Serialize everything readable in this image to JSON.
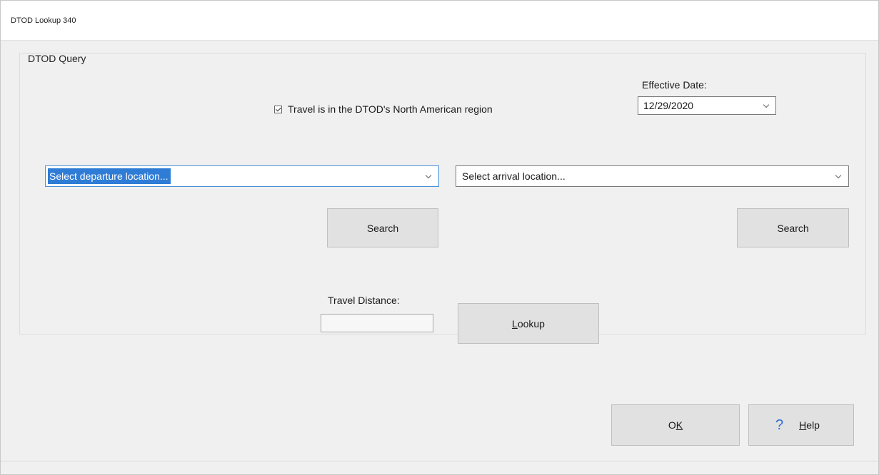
{
  "window": {
    "title": "DTOD Lookup 340"
  },
  "group": {
    "label": "DTOD Query"
  },
  "region_checkbox": {
    "label": "Travel is in the DTOD's North American region",
    "checked": true
  },
  "effective_date": {
    "label": "Effective Date:",
    "value": "12/29/2020"
  },
  "departure": {
    "value": "Select departure location..."
  },
  "arrival": {
    "value": "Select arrival location..."
  },
  "buttons": {
    "search": "Search",
    "lookup_prefix": "L",
    "lookup_rest": "ookup",
    "ok_prefix": "O",
    "ok_underline": "K",
    "help_underline": "H",
    "help_rest": "elp",
    "help_icon": "?"
  },
  "travel_distance": {
    "label": "Travel Distance:",
    "value": ""
  },
  "colors": {
    "selection": "#2f7cd6",
    "help_icon": "#2f6fd1"
  }
}
